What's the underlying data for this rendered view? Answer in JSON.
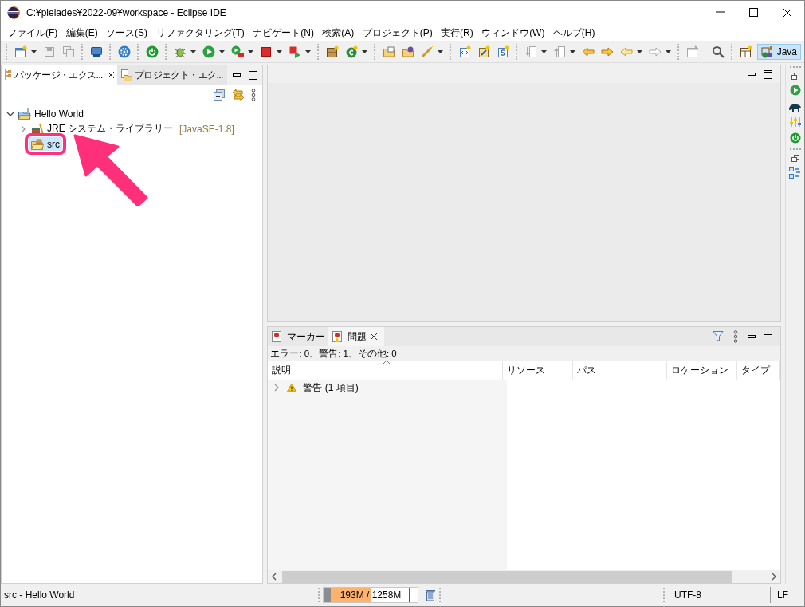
{
  "window": {
    "title": "C:¥pleiades¥2022-09¥workspace - Eclipse IDE"
  },
  "menu": [
    "ファイル(F)",
    "編集(E)",
    "ソース(S)",
    "リファクタリング(T)",
    "ナビゲート(N)",
    "検索(A)",
    "プロジェクト(P)",
    "実行(R)",
    "ウィンドウ(W)",
    "ヘルプ(H)"
  ],
  "toolbar": [
    {
      "kind": "sep"
    },
    {
      "kind": "new",
      "disabled": false,
      "dropdown": true
    },
    {
      "kind": "save",
      "disabled": true
    },
    {
      "kind": "saveall",
      "disabled": true
    },
    {
      "kind": "sep"
    },
    {
      "kind": "monitor",
      "disabled": false
    },
    {
      "kind": "sep"
    },
    {
      "kind": "gear",
      "disabled": false
    },
    {
      "kind": "sep"
    },
    {
      "kind": "power",
      "disabled": false
    },
    {
      "kind": "sep"
    },
    {
      "kind": "bug",
      "disabled": false,
      "dropdown": true
    },
    {
      "kind": "run",
      "disabled": false,
      "dropdown": true
    },
    {
      "kind": "coverage",
      "disabled": false,
      "dropdown": true
    },
    {
      "kind": "stop",
      "disabled": false,
      "dropdown": true
    },
    {
      "kind": "launch",
      "disabled": false,
      "dropdown": true
    },
    {
      "kind": "sep"
    },
    {
      "kind": "package",
      "disabled": false
    },
    {
      "kind": "class",
      "disabled": false,
      "dropdown": true
    },
    {
      "kind": "sep"
    },
    {
      "kind": "folder",
      "disabled": false
    },
    {
      "kind": "folderdb",
      "disabled": false
    },
    {
      "kind": "wand",
      "disabled": false,
      "dropdown": true
    },
    {
      "kind": "sep"
    },
    {
      "kind": "xml",
      "disabled": false
    },
    {
      "kind": "sparkle",
      "disabled": false
    },
    {
      "kind": "script",
      "disabled": false
    },
    {
      "kind": "sep"
    },
    {
      "kind": "down",
      "disabled": true,
      "dropdown": true
    },
    {
      "kind": "up",
      "disabled": true,
      "dropdown": true
    },
    {
      "kind": "backedit",
      "disabled": false
    },
    {
      "kind": "fwdedit",
      "disabled": false
    },
    {
      "kind": "back",
      "disabled": false,
      "dropdown": true
    },
    {
      "kind": "forward",
      "disabled": true,
      "dropdown": true
    },
    {
      "kind": "sep"
    },
    {
      "kind": "pin",
      "disabled": true
    },
    {
      "kind": "spacer"
    },
    {
      "kind": "search",
      "disabled": false
    },
    {
      "kind": "sep"
    },
    {
      "kind": "perspective",
      "disabled": false
    }
  ],
  "perspectives": [
    {
      "label": "Java",
      "selected": true
    }
  ],
  "explorer": {
    "tabs": [
      {
        "label": "パッケージ・エクス...",
        "selected": true
      },
      {
        "label": "プロジェクト・エク...",
        "selected": false
      }
    ],
    "tree": [
      {
        "kind": "project",
        "label": "Hello World",
        "expanded": true,
        "selected": false,
        "highlighted": false,
        "children": [
          {
            "kind": "library",
            "label": "JRE システム・ライブラリー",
            "decoration": "[JavaSE-1.8]",
            "expanded": false,
            "selected": false,
            "highlighted": false
          },
          {
            "kind": "source",
            "label": "src",
            "selected": true,
            "highlighted": true
          }
        ]
      }
    ]
  },
  "problems": {
    "tabs": [
      {
        "label": "マーカー",
        "selected": false
      },
      {
        "label": "問題",
        "selected": true
      }
    ],
    "summary": "エラー: 0、警告: 1、その他: 0",
    "columns": [
      "説明",
      "リソース",
      "パス",
      "ロケーション",
      "タイプ"
    ],
    "rows": [
      {
        "label": "警告 (1 項目)",
        "expanded": false
      }
    ]
  },
  "status_bar": {
    "selection": "src - Hello World",
    "heap": {
      "text": "193M / 1258M",
      "level": 0.5
    },
    "encoding": "UTF-8",
    "line_delimiter": "LF"
  }
}
